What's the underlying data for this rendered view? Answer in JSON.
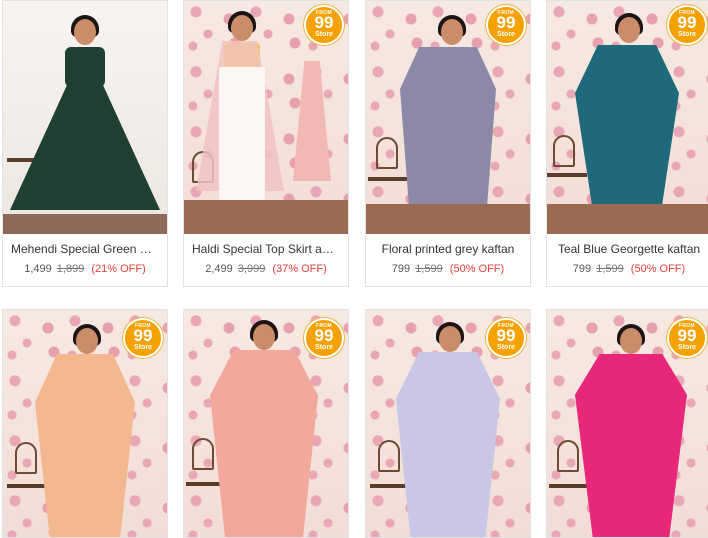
{
  "badge": {
    "from": "FROM",
    "value": "99",
    "store": "Store"
  },
  "products": [
    {
      "name": "Mehendi Special Green Ge...",
      "price": "1,499",
      "mrp": "1,899",
      "off": "(21% OFF)",
      "dress_color": "#1f3f32"
    },
    {
      "name": "Haldi Special Top Skirt and...",
      "price": "2,499",
      "mrp": "3,999",
      "off": "(37% OFF)",
      "dress_color": "#f1c3c0"
    },
    {
      "name": "Floral printed grey kaftan",
      "price": "799",
      "mrp": "1,599",
      "off": "(50% OFF)",
      "dress_color": "#8c88a8"
    },
    {
      "name": "Teal Blue Georgette kaftan",
      "price": "799",
      "mrp": "1,599",
      "off": "(50% OFF)",
      "dress_color": "#1f6a7a"
    },
    {
      "dress_color": "#f4b890"
    },
    {
      "dress_color": "#f2a89a"
    },
    {
      "dress_color": "#c9c6e6"
    },
    {
      "dress_color": "#e8267a"
    }
  ]
}
